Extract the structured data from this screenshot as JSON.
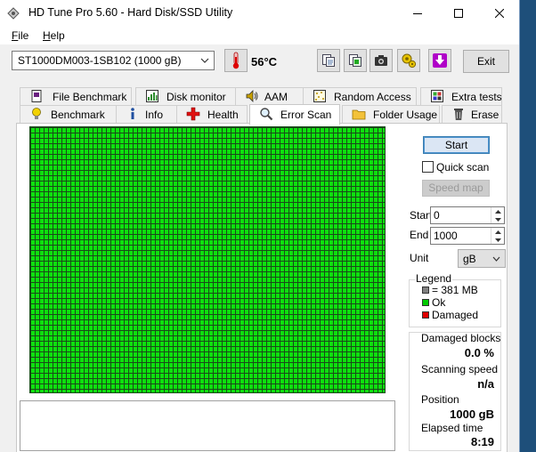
{
  "window": {
    "title": "HD Tune Pro 5.60 - Hard Disk/SSD Utility"
  },
  "menu": {
    "file": "File",
    "help": "Help"
  },
  "toolbar": {
    "drive": "ST1000DM003-1SB102 (1000 gB)",
    "temperature": "56°C",
    "exit_label": "Exit"
  },
  "tabs": {
    "row1": [
      "File Benchmark",
      "Disk monitor",
      "AAM",
      "Random Access",
      "Extra tests"
    ],
    "row2": [
      "Benchmark",
      "Info",
      "Health",
      "Error Scan",
      "Folder Usage",
      "Erase"
    ],
    "active": "Error Scan"
  },
  "scan": {
    "start_label": "Start",
    "quick_scan_label": "Quick scan",
    "quick_scan_checked": false,
    "speed_map_label": "Speed map",
    "start_field_label": "Start",
    "start_value": "0",
    "end_field_label": "End",
    "end_value": "1000",
    "unit_label": "Unit",
    "unit_value": "gB"
  },
  "legend": {
    "title": "Legend",
    "block_size": "= 381 MB",
    "ok": "Ok",
    "damaged": "Damaged",
    "colors": {
      "block": "#808080",
      "ok": "#00cc00",
      "damaged": "#e00000"
    }
  },
  "stats": {
    "damaged_label": "Damaged blocks",
    "damaged_value": "0.0 %",
    "speed_label": "Scanning speed",
    "speed_value": "n/a",
    "position_label": "Position",
    "position_value": "1000 gB",
    "elapsed_label": "Elapsed time",
    "elapsed_value": "8:19"
  },
  "colors": {
    "scan_ok": "#0ee00e",
    "grid_line": "#1a4a1a"
  }
}
